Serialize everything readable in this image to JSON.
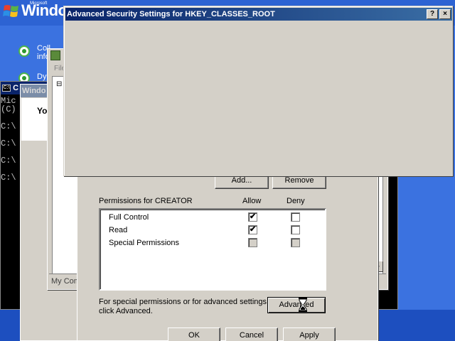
{
  "setup": {
    "microsoft": "Microsoft",
    "windows_brand": "Windo",
    "step1_label": "Coll",
    "step1_label_2": "info",
    "step2_label": "Dy"
  },
  "cmd": {
    "title": "C",
    "lines": [
      "Mic",
      "(C)",
      "C:\\",
      "C:\\",
      "C:\\",
      "C:\\"
    ]
  },
  "windows_dialog": {
    "title": "Windo",
    "text": "Yo"
  },
  "mmc": {
    "menu": "File",
    "tree_item": "⊟",
    "status": "My Comp"
  },
  "security": {
    "add_button": "Add...",
    "remove_button": "Remove",
    "permissions_for": "Permissions for CREATOR",
    "allow_header": "Allow",
    "deny_header": "Deny",
    "permissions": [
      {
        "name": "Full Control",
        "allow": "checked",
        "deny": "unchecked"
      },
      {
        "name": "Read",
        "allow": "checked",
        "deny": "unchecked"
      },
      {
        "name": "Special Permissions",
        "allow": "greyed",
        "deny": "greyed"
      }
    ],
    "advanced_note_1": "For special permissions or for advanced settings,",
    "advanced_note_2": "click Advanced.",
    "advanced_button": "Advanced",
    "ok_button": "OK",
    "cancel_button": "Cancel",
    "apply_button": "Apply"
  },
  "advanced": {
    "title": "Advanced Security Settings for HKEY_CLASSES_ROOT",
    "help_button": "?",
    "close_button": "×"
  },
  "colors": {
    "titlebar_active": "#0a246a",
    "titlebar_active_end": "#3a6ea5",
    "dialog_face": "#d4d0c8",
    "xp_setup_blue": "#3b72e0"
  }
}
